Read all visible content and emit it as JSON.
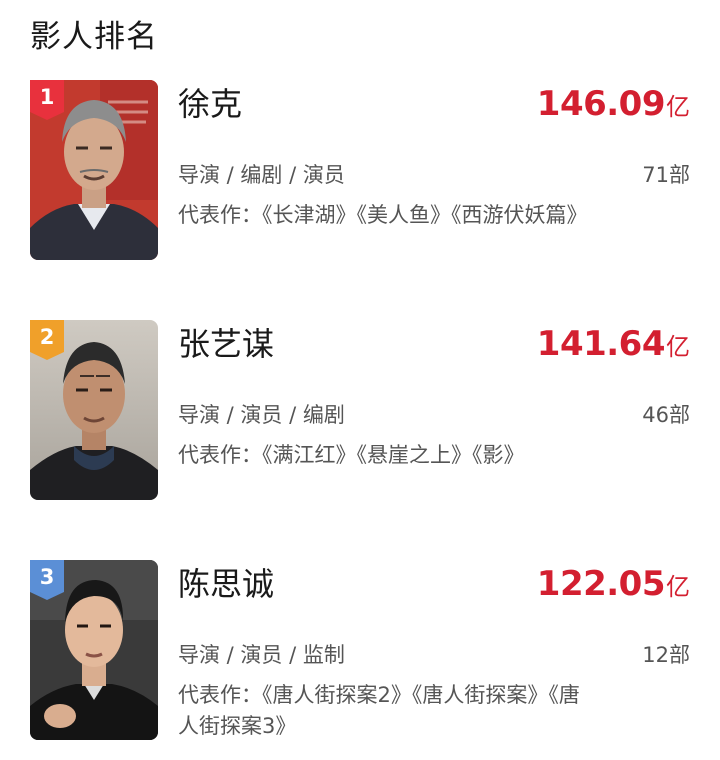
{
  "page": {
    "title": "影人排名"
  },
  "colors": {
    "accent_red": "#d31f30",
    "badge_red": "#e8313d",
    "badge_orange": "#f0a02a",
    "badge_blue": "#5b8fd6",
    "text_primary": "#1a1a1a",
    "text_secondary": "#555555"
  },
  "rankings": [
    {
      "rank": "1",
      "badge_color": "#e8313d",
      "name": "徐克",
      "box_office_value": "146.09",
      "box_office_unit": "亿",
      "roles": "导演 / 编剧 / 演员",
      "work_count": "71部",
      "representative_works": "代表作：《长津湖》《美人鱼》《西游伏妖篇》",
      "photo_icon": "person-photo-icon"
    },
    {
      "rank": "2",
      "badge_color": "#f0a02a",
      "name": "张艺谋",
      "box_office_value": "141.64",
      "box_office_unit": "亿",
      "roles": "导演 / 演员 / 编剧",
      "work_count": "46部",
      "representative_works": "代表作：《满江红》《悬崖之上》《影》",
      "photo_icon": "person-photo-icon"
    },
    {
      "rank": "3",
      "badge_color": "#5b8fd6",
      "name": "陈思诚",
      "box_office_value": "122.05",
      "box_office_unit": "亿",
      "roles": "导演 / 演员 / 监制",
      "work_count": "12部",
      "representative_works": "代表作：《唐人街探案2》《唐人街探案》《唐人街探案3》",
      "photo_icon": "person-photo-icon"
    }
  ]
}
